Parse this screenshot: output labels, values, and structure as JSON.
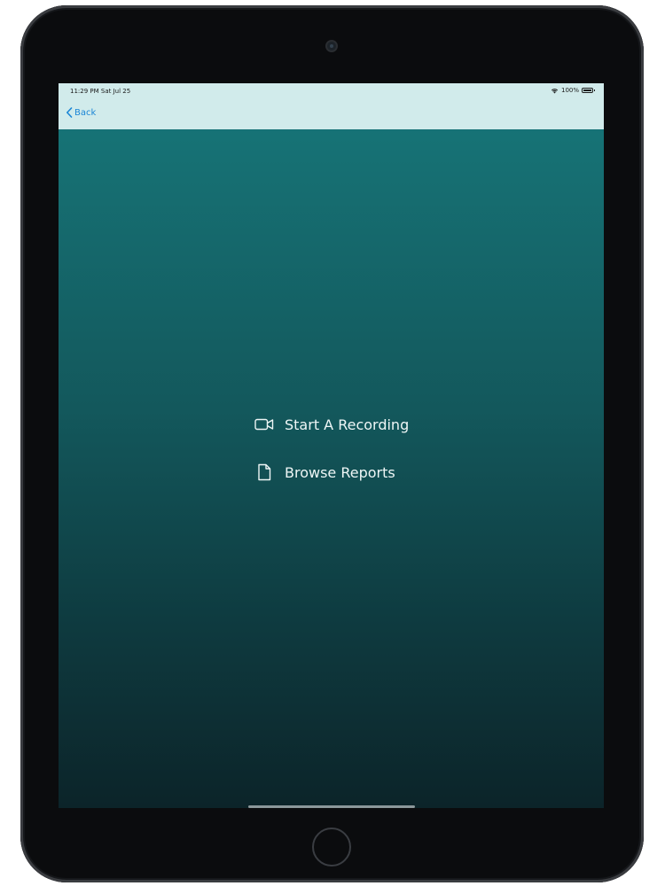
{
  "status_bar": {
    "time_date": "11:29 PM  Sat Jul 25",
    "battery_text": "100%",
    "battery_level": 1.0,
    "icons": [
      "wifi-icon",
      "battery-icon"
    ]
  },
  "nav": {
    "back_label": "Back",
    "back_icon": "chevron-left-icon",
    "bar_color": "#d1ebeb",
    "accent_color": "#1b86d6"
  },
  "menu": {
    "items": [
      {
        "label": "Start A Recording",
        "icon": "video-camera-icon"
      },
      {
        "label": "Browse Reports",
        "icon": "document-icon"
      }
    ]
  },
  "colors": {
    "background_top": "#17777a",
    "background_bottom": "#0c2429",
    "menu_text": "#eef6f6"
  }
}
